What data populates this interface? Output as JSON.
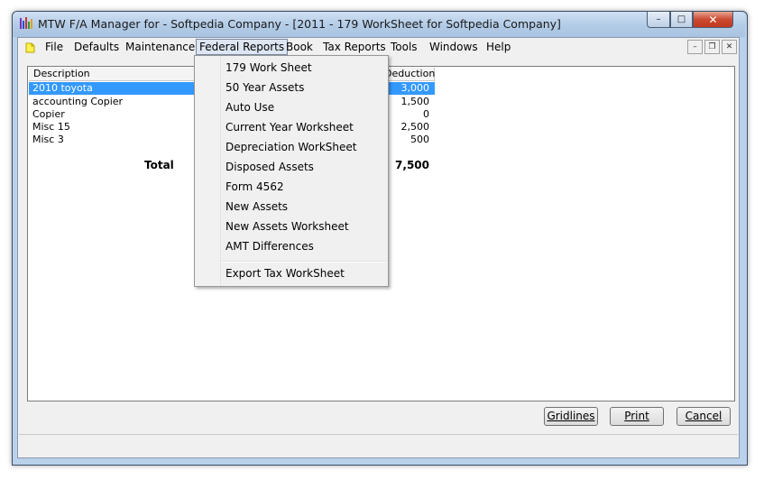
{
  "window": {
    "title": "MTW F/A Manager for - Softpedia Company - [2011 - 179 WorkSheet for Softpedia Company]",
    "controls": {
      "minimize": "–",
      "maximize": "□",
      "close": "✕"
    }
  },
  "menubar": {
    "items": [
      "File",
      "Defaults",
      "Maintenance",
      "Federal Reports",
      "Book",
      "Tax Reports",
      "Tools",
      "Windows",
      "Help"
    ],
    "active": "Federal Reports",
    "mdi_controls": {
      "minimize": "–",
      "restore": "❐",
      "close": "✕"
    }
  },
  "table": {
    "columns": [
      "Description",
      "Deduction"
    ],
    "rows": [
      {
        "description": "2010 toyota",
        "deduction": "3,000",
        "selected": true
      },
      {
        "description": "accounting Copier",
        "deduction": "1,500",
        "selected": false
      },
      {
        "description": "Copier",
        "deduction": "0",
        "selected": false
      },
      {
        "description": "Misc 15",
        "deduction": "2,500",
        "selected": false
      },
      {
        "description": "Misc 3",
        "deduction": "500",
        "selected": false
      }
    ],
    "total_label": "Total",
    "total_value": "7,500"
  },
  "federal_reports_menu": {
    "items": [
      "179 Work Sheet",
      "50 Year Assets",
      "Auto Use",
      "Current Year Worksheet",
      "Depreciation WorkSheet",
      "Disposed Assets",
      "Form 4562",
      "New Assets",
      "New Assets Worksheet",
      "AMT Differences"
    ],
    "after_separator": "Export Tax WorkSheet"
  },
  "buttons": {
    "gridlines": "Gridlines",
    "print": "Print",
    "cancel": "Cancel"
  },
  "colors": {
    "selection": "#3399ff",
    "close_button": "#c8452c",
    "titlebar": "#b9d1ea"
  }
}
